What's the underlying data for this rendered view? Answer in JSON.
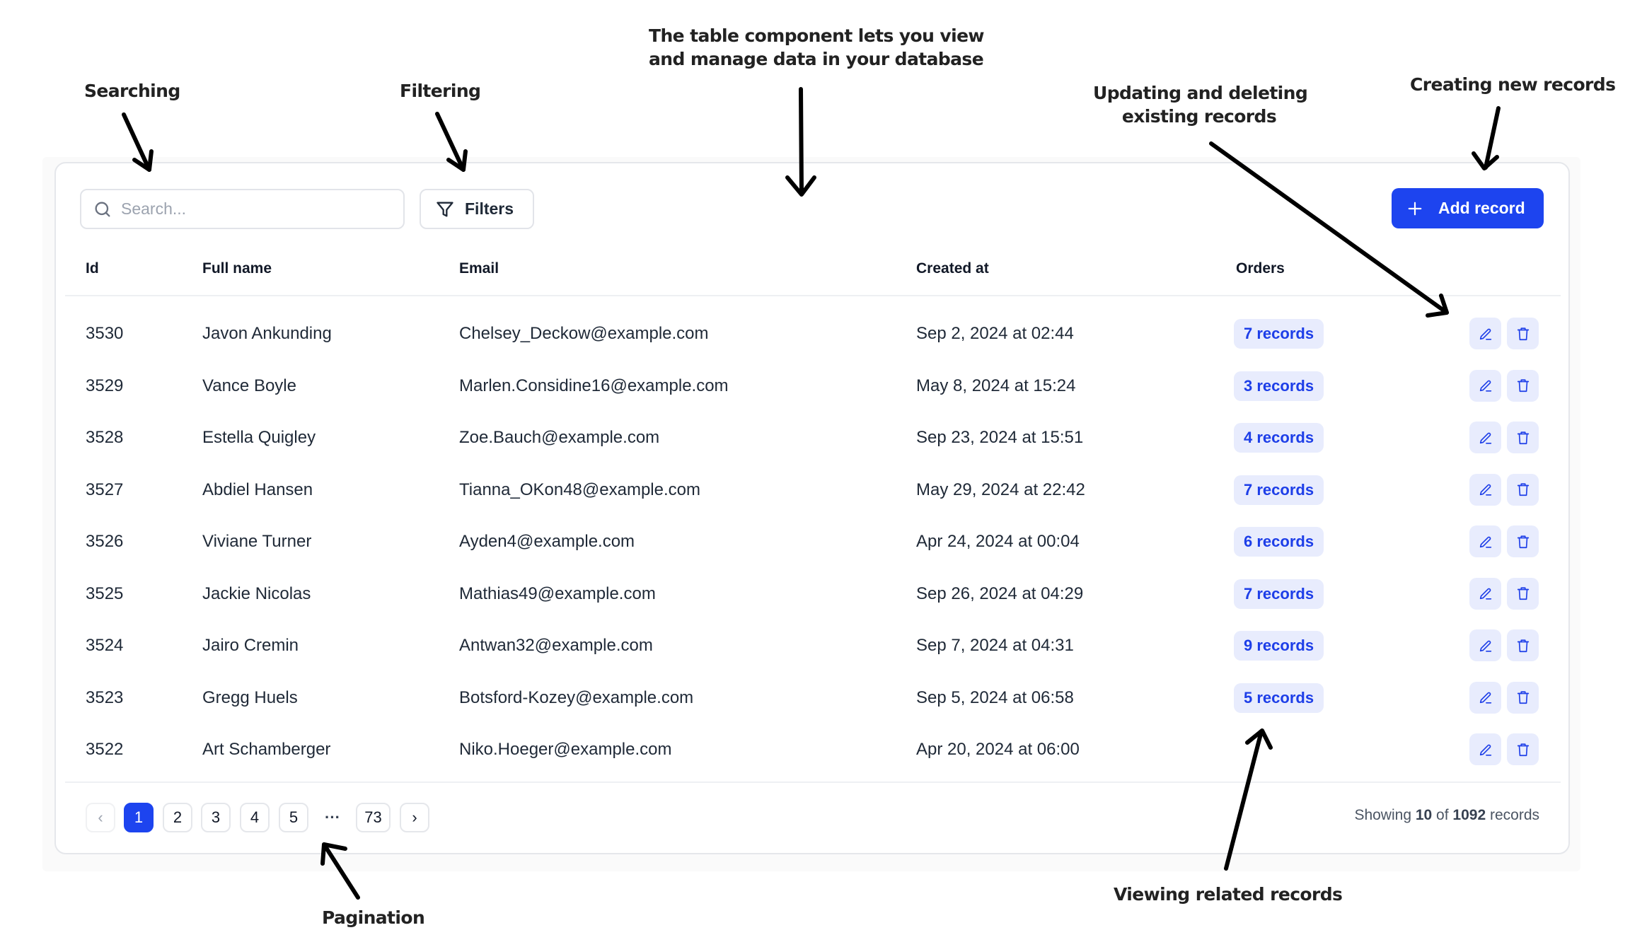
{
  "annotations": {
    "title_line1": "The table component lets you view",
    "title_line2": "and manage data in your database",
    "searching": "Searching",
    "filtering": "Filtering",
    "updating_line1": "Updating and deleting",
    "updating_line2": "existing records",
    "creating": "Creating new records",
    "pagination": "Pagination",
    "viewing": "Viewing related records"
  },
  "toolbar": {
    "search_placeholder": "Search...",
    "search_value": "",
    "search_icon": "search-icon",
    "filters_label": "Filters",
    "filters_icon": "filter-funnel-icon",
    "add_label": "Add record",
    "add_icon": "plus-icon"
  },
  "table": {
    "columns": [
      "Id",
      "Full name",
      "Email",
      "Created at",
      "Orders"
    ],
    "rows": [
      {
        "id": "3530",
        "name": "Javon Ankunding",
        "email": "Chelsey_Deckow@example.com",
        "created": "Sep 2, 2024 at 02:44",
        "orders": "7 records"
      },
      {
        "id": "3529",
        "name": "Vance Boyle",
        "email": "Marlen.Considine16@example.com",
        "created": "May 8, 2024 at 15:24",
        "orders": "3 records"
      },
      {
        "id": "3528",
        "name": "Estella Quigley",
        "email": "Zoe.Bauch@example.com",
        "created": "Sep 23, 2024 at 15:51",
        "orders": "4 records"
      },
      {
        "id": "3527",
        "name": "Abdiel Hansen",
        "email": "Tianna_OKon48@example.com",
        "created": "May 29, 2024 at 22:42",
        "orders": "7 records"
      },
      {
        "id": "3526",
        "name": "Viviane Turner",
        "email": "Ayden4@example.com",
        "created": "Apr 24, 2024 at 00:04",
        "orders": "6 records"
      },
      {
        "id": "3525",
        "name": "Jackie Nicolas",
        "email": "Mathias49@example.com",
        "created": "Sep 26, 2024 at 04:29",
        "orders": "7 records"
      },
      {
        "id": "3524",
        "name": "Jairo Cremin",
        "email": "Antwan32@example.com",
        "created": "Sep 7, 2024 at 04:31",
        "orders": "9 records"
      },
      {
        "id": "3523",
        "name": "Gregg Huels",
        "email": "Botsford-Kozey@example.com",
        "created": "Sep 5, 2024 at 06:58",
        "orders": "5 records"
      },
      {
        "id": "3522",
        "name": "Art Schamberger",
        "email": "Niko.Hoeger@example.com",
        "created": "Apr 20, 2024 at 06:00",
        "orders": null
      }
    ],
    "row_actions": [
      "edit-pencil-icon",
      "delete-trash-icon"
    ]
  },
  "pagination": {
    "prev": "‹",
    "pages": [
      "1",
      "2",
      "3",
      "4",
      "5"
    ],
    "ellipsis": "···",
    "last": "73",
    "next": "›",
    "current": "1"
  },
  "footer": {
    "showing_prefix": "Showing",
    "showing_count": "10",
    "showing_of": "of",
    "showing_total": "1092",
    "showing_suffix": "records"
  },
  "colors": {
    "accent": "#1d44ef",
    "badge_bg": "#e8ecfd",
    "badge_text": "#1d3ee8",
    "border": "#e5e7eb"
  }
}
